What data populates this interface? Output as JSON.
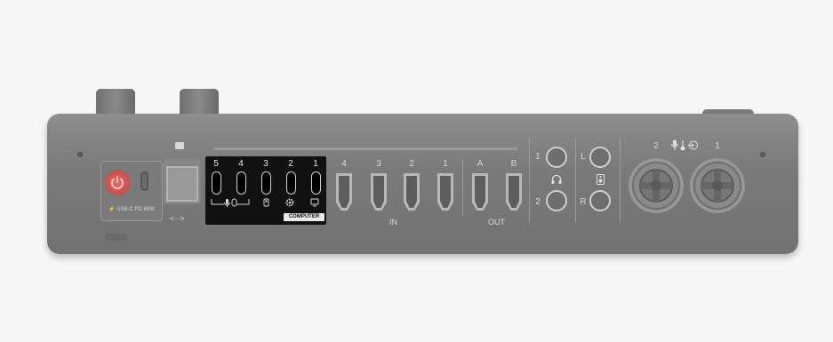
{
  "power": {
    "pd_label": "USB-C PD 65W"
  },
  "ethernet": {
    "label": "<··>"
  },
  "usb_ports": {
    "numbers": [
      "5",
      "4",
      "3",
      "2",
      "1"
    ],
    "computer_label": "COMPUTER"
  },
  "hdmi": {
    "in_numbers": [
      "4",
      "3",
      "2",
      "1"
    ],
    "in_label": "IN",
    "out_letters": [
      "A",
      "B"
    ],
    "out_label": "OUT"
  },
  "headphones": {
    "numbers": [
      "1",
      "2"
    ]
  },
  "line_out": {
    "left": "L",
    "right": "R"
  },
  "mic_inputs": {
    "numbers": [
      "2",
      "1"
    ]
  }
}
